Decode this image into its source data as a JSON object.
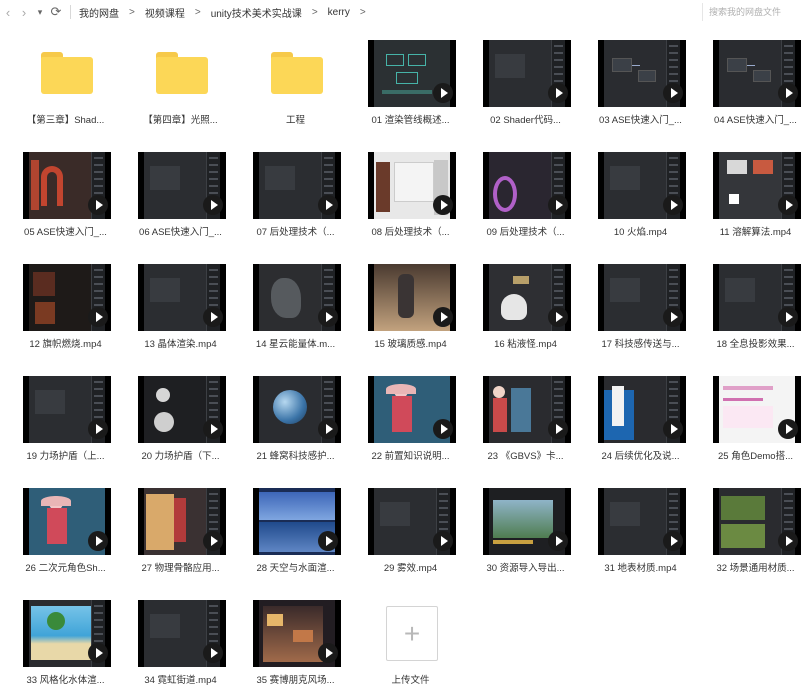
{
  "nav": {
    "back_icon": "‹",
    "forward_icon": "›",
    "dropdown_icon": "▾",
    "refresh_icon": "⟳"
  },
  "breadcrumb": [
    "我的网盘",
    "视频课程",
    "unity技术美术实战课",
    "kerry"
  ],
  "breadcrumb_separator": ">",
  "search": {
    "placeholder": "搜索我的网盘文件"
  },
  "items": [
    {
      "type": "folder",
      "label": "【第三章】Shad..."
    },
    {
      "type": "folder",
      "label": "【第四章】光照..."
    },
    {
      "type": "folder",
      "label": "工程"
    },
    {
      "type": "video",
      "label": "01 渲染管线概述...",
      "art": "diagram"
    },
    {
      "type": "video",
      "label": "02 Shader代码...",
      "art": "dark"
    },
    {
      "type": "video",
      "label": "03 ASE快速入门_...",
      "art": "nodes"
    },
    {
      "type": "video",
      "label": "04 ASE快速入门_...",
      "art": "nodes"
    },
    {
      "type": "video",
      "label": "05 ASE快速入门_...",
      "art": "red"
    },
    {
      "type": "video",
      "label": "06 ASE快速入门_...",
      "art": "dark"
    },
    {
      "type": "video",
      "label": "07 后处理技术（...",
      "art": "dark"
    },
    {
      "type": "video",
      "label": "08 后处理技术（...",
      "art": "light"
    },
    {
      "type": "video",
      "label": "09 后处理技术（...",
      "art": "purple"
    },
    {
      "type": "video",
      "label": "10 火焰.mp4",
      "art": "dark"
    },
    {
      "type": "video",
      "label": "11 溶解算法.mp4",
      "art": "white"
    },
    {
      "type": "video",
      "label": "12 旗帜燃烧.mp4",
      "art": "fire"
    },
    {
      "type": "video",
      "label": "13 晶体渲染.mp4",
      "art": "dark"
    },
    {
      "type": "video",
      "label": "14 星云能量体.m...",
      "art": "rock"
    },
    {
      "type": "video",
      "label": "15 玻璃质感.mp4",
      "art": "beige"
    },
    {
      "type": "video",
      "label": "16 粘液怪.mp4",
      "art": "ghost"
    },
    {
      "type": "video",
      "label": "17 科技感传送与...",
      "art": "dark"
    },
    {
      "type": "video",
      "label": "18 全息投影效果...",
      "art": "dark"
    },
    {
      "type": "video",
      "label": "19 力场护盾（上...",
      "art": "dark"
    },
    {
      "type": "video",
      "label": "20 力场护盾（下...",
      "art": "sphere"
    },
    {
      "type": "video",
      "label": "21 蜂窝科技感护...",
      "art": "blueball"
    },
    {
      "type": "video",
      "label": "22 前置知识说明...",
      "art": "anime"
    },
    {
      "type": "video",
      "label": "23 《GBVS》卡...",
      "art": "anime2"
    },
    {
      "type": "video",
      "label": "24 后续优化及说...",
      "art": "anime3"
    },
    {
      "type": "video",
      "label": "25 角色Demo搭...",
      "art": "pinkweb"
    },
    {
      "type": "video",
      "label": "26 二次元角色Sh...",
      "art": "anime"
    },
    {
      "type": "video",
      "label": "27 物理骨骼应用...",
      "art": "anime4"
    },
    {
      "type": "video",
      "label": "28 天空与水面渲...",
      "art": "sky"
    },
    {
      "type": "video",
      "label": "29 雾效.mp4",
      "art": "dark"
    },
    {
      "type": "video",
      "label": "30 资源导入导出...",
      "art": "landscape"
    },
    {
      "type": "video",
      "label": "31 地表材质.mp4",
      "art": "dark"
    },
    {
      "type": "video",
      "label": "32 场景通用材质...",
      "art": "green"
    },
    {
      "type": "video",
      "label": "33 风格化水体渲...",
      "art": "beach"
    },
    {
      "type": "video",
      "label": "34 霓虹街道.mp4",
      "art": "dark"
    },
    {
      "type": "video",
      "label": "35 赛博朋克风场...",
      "art": "city"
    },
    {
      "type": "upload",
      "label": "上传文件",
      "icon": "+"
    }
  ]
}
